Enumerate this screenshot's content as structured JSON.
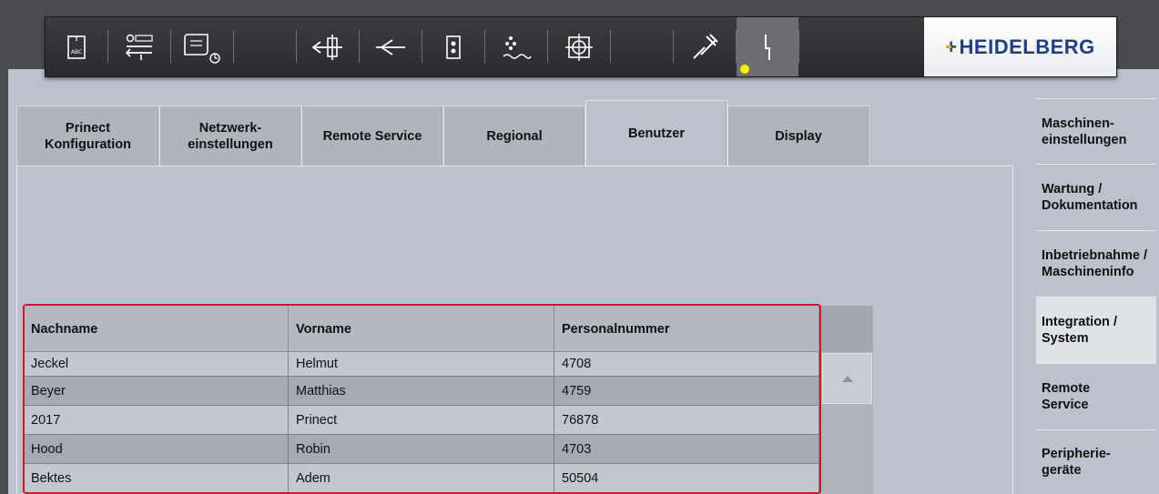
{
  "toolbar": {
    "buttons": [
      {
        "name": "job-data-icon",
        "icon": "document-abc"
      },
      {
        "name": "print-to-paper-icon",
        "icon": "feed-counter"
      },
      {
        "name": "job-queue-icon",
        "icon": "paper-roll-clock"
      },
      {
        "name": "feeder-icon",
        "icon": "feeder"
      },
      {
        "name": "infeed-icon",
        "icon": "infeed"
      },
      {
        "name": "printing-unit-icon",
        "icon": "printing-unit"
      },
      {
        "name": "dampening-icon",
        "icon": "dampening"
      },
      {
        "name": "register-icon",
        "icon": "register-target"
      },
      {
        "name": "maintenance-icon",
        "icon": "wrench"
      },
      {
        "name": "service-icon",
        "icon": "lightning"
      }
    ],
    "logo_text": "HEIDELBERG",
    "status_led_color": "#ffee00"
  },
  "tabs": [
    {
      "label": "Prinect\nKonfiguration"
    },
    {
      "label": "Netzwerk-\neinstellungen"
    },
    {
      "label": "Remote Service"
    },
    {
      "label": "Regional"
    },
    {
      "label": "Benutzer",
      "active": true
    },
    {
      "label": "Display"
    }
  ],
  "table": {
    "columns": [
      "Nachname",
      "Vorname",
      "Personalnummer"
    ],
    "rows": [
      [
        "Jeckel",
        "Helmut",
        "4708"
      ],
      [
        "Beyer",
        "Matthias",
        "4759"
      ],
      [
        "2017",
        "Prinect",
        "76878"
      ],
      [
        "Hood",
        "Robin",
        "4703"
      ],
      [
        "Bektes",
        "Adem",
        "50504"
      ]
    ],
    "highlight_color": "#d0182a"
  },
  "sidebar": {
    "items": [
      {
        "label": "Maschinen-\neinstellungen"
      },
      {
        "label": "Wartung /\nDokumentation"
      },
      {
        "label": "Inbetriebnahme /\nMaschineninfo"
      },
      {
        "label": "Integration /\nSystem",
        "active": true
      },
      {
        "label": "Remote\nService"
      },
      {
        "label": "Peripherie-\ngeräte"
      }
    ]
  }
}
